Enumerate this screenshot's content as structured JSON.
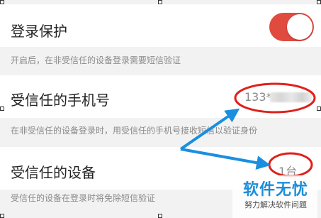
{
  "login_protection": {
    "title": "登录保护",
    "enabled": true,
    "description": "开启后，在非受信任的设备登录需要短信验证"
  },
  "trusted_phone": {
    "title": "受信任的手机号",
    "value_visible": "133*",
    "description": "在非受信任的设备登录时，用受信任的手机号接收短信以验证身份"
  },
  "trusted_devices": {
    "title": "受信任的设备",
    "value": "1台",
    "description": "受信任的设备在登录时将免除短信验证"
  },
  "watermark": {
    "name": "软件无忧",
    "tagline": "努力解决软件问题"
  },
  "annotation_color": "#e0201a",
  "arrow_color": "#1a8fe0",
  "toggle_on_color": "#e04a3f"
}
